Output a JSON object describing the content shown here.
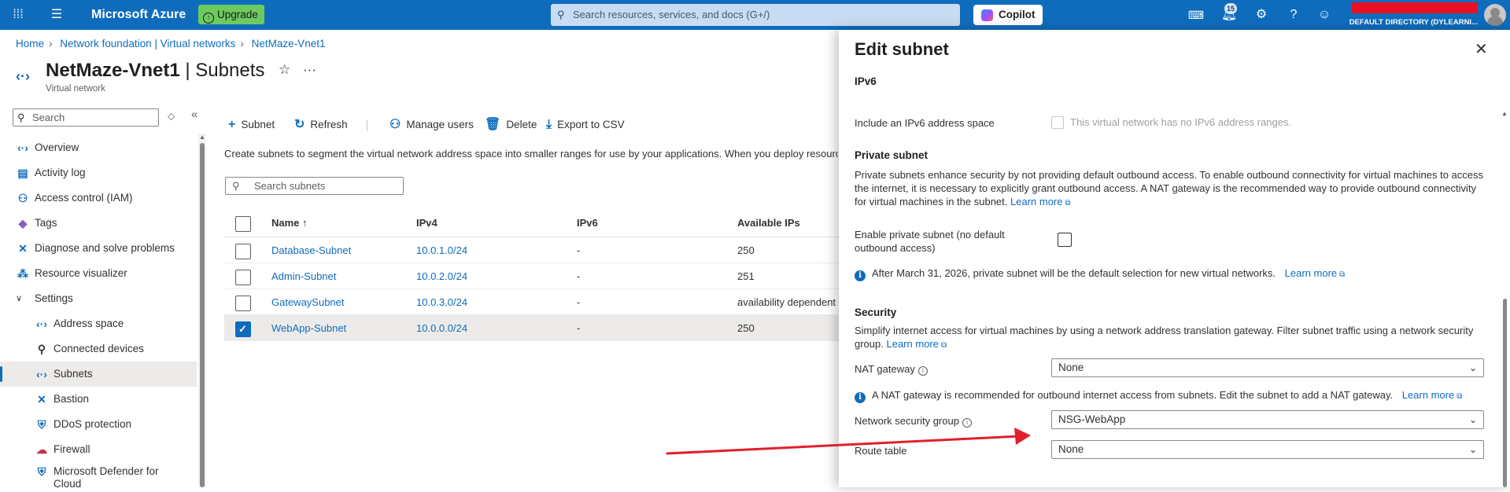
{
  "topbar": {
    "brand": "Microsoft Azure",
    "upgrade_label": "Upgrade",
    "search_placeholder": "Search resources, services, and docs (G+/)",
    "copilot_label": "Copilot",
    "notification_count": "15",
    "directory": "DEFAULT DIRECTORY (DYLEARNI..."
  },
  "breadcrumb": [
    "Home",
    "Network foundation | Virtual networks",
    "NetMaze-Vnet1"
  ],
  "resource": {
    "name": "NetMaze-Vnet1",
    "section": " | Subnets",
    "type": "Virtual network"
  },
  "leftnav": {
    "search_placeholder": "Search",
    "items": [
      {
        "label": "Overview",
        "icon": "overview-icon",
        "glyph": "‹·›",
        "color": "#0f6cbd"
      },
      {
        "label": "Activity log",
        "icon": "activity-log-icon",
        "glyph": "▤",
        "color": "#0f6cbd"
      },
      {
        "label": "Access control (IAM)",
        "icon": "iam-icon",
        "glyph": "⚇",
        "color": "#0f6cbd"
      },
      {
        "label": "Tags",
        "icon": "tag-icon",
        "glyph": "◆",
        "color": "#8a5ec6"
      },
      {
        "label": "Diagnose and solve problems",
        "icon": "diagnose-icon",
        "glyph": "✕",
        "color": "#0f6cbd"
      },
      {
        "label": "Resource visualizer",
        "icon": "visualizer-icon",
        "glyph": "⁂",
        "color": "#0f6cbd"
      }
    ],
    "settings_label": "Settings",
    "settings_items": [
      {
        "label": "Address space",
        "icon": "address-space-icon",
        "glyph": "‹·›",
        "color": "#0f6cbd",
        "selected": false
      },
      {
        "label": "Connected devices",
        "icon": "connected-devices-icon",
        "glyph": "⚲",
        "color": "#323130",
        "selected": false
      },
      {
        "label": "Subnets",
        "icon": "subnets-icon",
        "glyph": "‹·›",
        "color": "#0f6cbd",
        "selected": true
      },
      {
        "label": "Bastion",
        "icon": "bastion-icon",
        "glyph": "✕",
        "color": "#0f6cbd",
        "selected": false
      },
      {
        "label": "DDoS protection",
        "icon": "ddos-shield-icon",
        "glyph": "⛨",
        "color": "#0f6cbd",
        "selected": false
      },
      {
        "label": "Firewall",
        "icon": "firewall-icon",
        "glyph": "☁",
        "color": "#c4314b",
        "selected": false
      }
    ],
    "defender_label_1": "Microsoft Defender for",
    "defender_label_2": "Cloud"
  },
  "toolbar": {
    "subnet": "Subnet",
    "refresh": "Refresh",
    "manage_users": "Manage users",
    "delete": "Delete",
    "export": "Export to CSV"
  },
  "main": {
    "intro": "Create subnets to segment the virtual network address space into smaller ranges for use by your applications. When you deploy resources into a subnet, Azure assigns the resource an IP address from the subnet.",
    "search_placeholder": "Search subnets"
  },
  "table": {
    "headers": {
      "name": "Name ↑",
      "ipv4": "IPv4",
      "ipv6": "IPv6",
      "avail": "Available IPs"
    },
    "rows": [
      {
        "name": "Database-Subnet",
        "ipv4": "10.0.1.0/24",
        "ipv6": "-",
        "avail": "250",
        "selected": false
      },
      {
        "name": "Admin-Subnet",
        "ipv4": "10.0.2.0/24",
        "ipv6": "-",
        "avail": "251",
        "selected": false
      },
      {
        "name": "GatewaySubnet",
        "ipv4": "10.0.3.0/24",
        "ipv6": "-",
        "avail": "availability dependent",
        "selected": false
      },
      {
        "name": "WebApp-Subnet",
        "ipv4": "10.0.0.0/24",
        "ipv6": "-",
        "avail": "250",
        "selected": true
      }
    ]
  },
  "panel": {
    "title": "Edit subnet",
    "ipv6_heading": "IPv6",
    "ipv6_label": "Include an IPv6 address space",
    "ipv6_note": "This virtual network has no IPv6 address ranges.",
    "private_heading": "Private subnet",
    "private_desc": "Private subnets enhance security by not providing default outbound access. To enable outbound connectivity for virtual machines to access the internet, it is necessary to explicitly grant outbound access. A NAT gateway is the recommended way to provide outbound connectivity for virtual machines in the subnet.",
    "learn_more": "Learn more",
    "private_label_1": "Enable private subnet (no default",
    "private_label_2": "outbound access)",
    "private_info": "After March 31, 2026, private subnet will be the default selection for new virtual networks.",
    "security_heading": "Security",
    "security_desc": "Simplify internet access for virtual machines by using a network address translation gateway. Filter subnet traffic using a network security group.",
    "nat_label": "NAT gateway",
    "nat_value": "None",
    "nat_info": "A NAT gateway is recommended for outbound internet access from subnets. Edit the subnet to add a NAT gateway.",
    "nsg_label": "Network security group",
    "nsg_value": "NSG-WebApp",
    "route_label": "Route table",
    "route_value": "None"
  },
  "colors": {
    "topbar": "#0f6cbd",
    "accent": "#0f6cbd",
    "annotation_arrow": "#e0202a",
    "upgrade": "#6ccb5f"
  }
}
